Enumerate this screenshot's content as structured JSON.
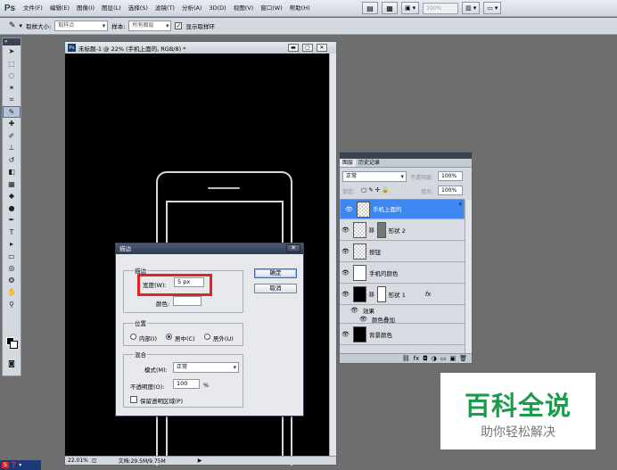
{
  "app": {
    "logo": "Ps",
    "menu": [
      "文件(F)",
      "编辑(E)",
      "图像(I)",
      "图层(L)",
      "选择(S)",
      "滤镜(T)",
      "分析(A)",
      "3D(D)",
      "视图(V)",
      "窗口(W)",
      "帮助(H)"
    ],
    "zoom_placeholder": "100%"
  },
  "options": {
    "sample_size_label": "取样大小:",
    "sample_size_value": "取样点",
    "sample_label": "样本:",
    "sample_value": "所有图层",
    "show_ring_label": "显示取样环"
  },
  "document": {
    "title": "未标题-1 @ 22% (手机上面的, RGB/8) *",
    "status_zoom": "22.01%",
    "status_doc": "文档:29.5M/9.75M"
  },
  "dialog": {
    "title": "描边",
    "stroke_group": "描边",
    "width_label": "宽度(W):",
    "width_value": "5 px",
    "color_label": "颜色:",
    "position_group": "位置",
    "pos_inside": "内部(I)",
    "pos_center": "居中(C)",
    "pos_outside": "居外(U)",
    "blend_group": "混合",
    "mode_label": "模式(M):",
    "mode_value": "正常",
    "opacity_label": "不透明度(O):",
    "opacity_value": "100",
    "opacity_unit": "%",
    "preserve_label": "保留透明区域(P)",
    "ok_label": "确定",
    "cancel_label": "取消"
  },
  "layers": {
    "tab_layers": "图层",
    "tab_history": "历史记录",
    "blend_value": "正常",
    "opacity_label": "不透明度:",
    "opacity_value": "100%",
    "lock_label": "锁定:",
    "fill_label": "填充:",
    "fill_value": "100%",
    "items": [
      {
        "name": "手机上面的"
      },
      {
        "name": "形状 2"
      },
      {
        "name": "按钮"
      },
      {
        "name": "手机的颜色"
      },
      {
        "name": "形状 1"
      },
      {
        "name": "背景颜色"
      }
    ],
    "effects_label": "效果",
    "color_overlay_label": "颜色叠加",
    "fx_badge": "fx"
  },
  "watermark": {
    "big": "百科全说",
    "small": "助你轻松解决"
  }
}
